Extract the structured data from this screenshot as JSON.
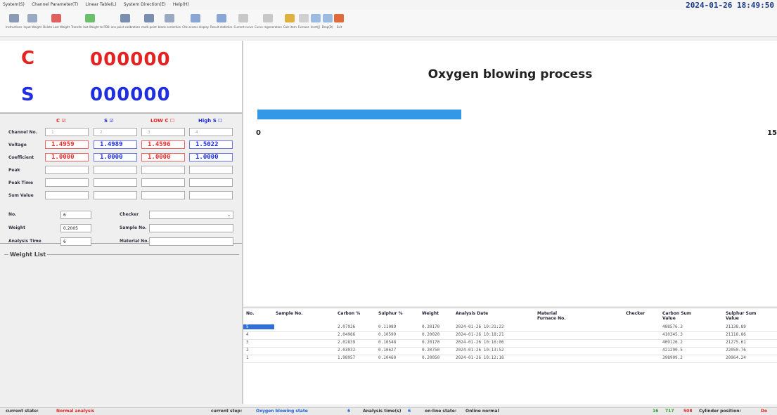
{
  "menu": {
    "items": [
      "System(S)",
      "Channel Parameter(T)",
      "Linear Table(L)",
      "System Direction(E)",
      "Help(H)"
    ],
    "datetime": "2024-01-26 18:49:50"
  },
  "toolbar": {
    "buttons": [
      {
        "label": "Instructions",
        "icon": "book-icon",
        "color": "#8a9bb5"
      },
      {
        "label": "Input Weight",
        "icon": "scale-icon",
        "color": "#9aa9c2"
      },
      {
        "label": "Delete Last Weight",
        "icon": "delete-icon",
        "color": "#e06060"
      },
      {
        "label": "Transfer last Weight to PDB",
        "icon": "transfer-icon",
        "color": "#6cbf6c"
      },
      {
        "label": "one point calibration",
        "icon": "calibration-icon",
        "color": "#7a8fb0"
      },
      {
        "label": "multi-point",
        "icon": "grid-icon",
        "color": "#7a8fb0"
      },
      {
        "label": "blank correction",
        "icon": "correction-icon",
        "color": "#9aa9c2"
      },
      {
        "label": "Chk access display",
        "icon": "magnifier-icon",
        "color": "#8aa6d4"
      },
      {
        "label": "Result statistics",
        "icon": "statistics-icon",
        "color": "#8aa6d4"
      },
      {
        "label": "Current curve",
        "icon": "curve-icon",
        "color": "#c8c8c8"
      },
      {
        "label": "Curve regeneration",
        "icon": "regenerate-icon",
        "color": "#c8c8c8"
      },
      {
        "label": "Calc item",
        "icon": "calc-icon",
        "color": "#e0b040"
      },
      {
        "label": "Furnace",
        "icon": "furnace-icon",
        "color": "#d0d0d0"
      },
      {
        "label": "Inert(J)",
        "icon": "inert-icon",
        "color": "#9bbbe0"
      },
      {
        "label": "Drop(D)",
        "icon": "drop-icon",
        "color": "#9bbbe0"
      },
      {
        "label": "Exit",
        "icon": "exit-icon",
        "color": "#e06a3a"
      }
    ]
  },
  "readout": {
    "c_label": "C",
    "c_value": "000000",
    "s_label": "S",
    "s_value": "000000",
    "c_color": "#e52222",
    "s_color": "#1f2ee0"
  },
  "channels": {
    "headers": [
      "C",
      "S",
      "LOW C",
      "High S"
    ],
    "checks": [
      true,
      true,
      false,
      false
    ],
    "rows": [
      {
        "label": "Channel No.",
        "values": [
          "1",
          "2",
          "3",
          "4"
        ]
      },
      {
        "label": "Voltage",
        "values": [
          "1.4959",
          "1.4989",
          "1.4596",
          "1.5022"
        ]
      },
      {
        "label": "Coefficient",
        "values": [
          "1.0000",
          "1.0000",
          "1.0000",
          "1.0000"
        ]
      },
      {
        "label": "Peak",
        "values": [
          "",
          "",
          "",
          ""
        ]
      },
      {
        "label": "Peak Time",
        "values": [
          "",
          "",
          "",
          ""
        ]
      },
      {
        "label": "Sum Value",
        "values": [
          "",
          "",
          "",
          ""
        ]
      }
    ]
  },
  "form": {
    "no_label": "No.",
    "no_value": "6",
    "weight_label": "Weight",
    "weight_value": "0.2005",
    "analysis_time_label": "Analysis Time",
    "analysis_time_value": "6",
    "checker_label": "Checker",
    "checker_value": "",
    "sample_label": "Sample No.",
    "sample_value": "",
    "material_label": "Material No.",
    "material_value": ""
  },
  "weight_list": {
    "title": "Weight List"
  },
  "process": {
    "title": "Oxygen blowing process",
    "progress_fraction": 0.33,
    "min_label": "0",
    "max_label": "15"
  },
  "results_table": {
    "headers": [
      "No.",
      "Sample No.",
      "Carbon %",
      "Sulphur %",
      "Weight",
      "Analysis Date",
      "Material Furnace No.",
      "Checker",
      "Carbon Sum Value",
      "Sulphur Sum Value"
    ],
    "rows": [
      {
        "no": "5",
        "sample": "",
        "carbon": "2.07926",
        "sulphur": "0.11089",
        "weight": "0.20170",
        "date": "2024-01-26 10:21:22",
        "furnace": "",
        "checker": "",
        "csum": "408576.3",
        "ssum": "21138.89"
      },
      {
        "no": "4",
        "sample": "",
        "carbon": "2.04986",
        "sulphur": "0.10599",
        "weight": "0.20020",
        "date": "2024-01-26 10:18:21",
        "furnace": "",
        "checker": "",
        "csum": "410345.3",
        "ssum": "21118.86"
      },
      {
        "no": "3",
        "sample": "",
        "carbon": "2.02839",
        "sulphur": "0.10548",
        "weight": "0.20170",
        "date": "2024-01-26 10:16:06",
        "furnace": "",
        "checker": "",
        "csum": "409126.2",
        "ssum": "21275.61"
      },
      {
        "no": "2",
        "sample": "",
        "carbon": "2.03032",
        "sulphur": "0.10627",
        "weight": "0.20750",
        "date": "2024-01-26 10:13:52",
        "furnace": "",
        "checker": "",
        "csum": "421290.5",
        "ssum": "22050.76"
      },
      {
        "no": "1",
        "sample": "",
        "carbon": "1.98957",
        "sulphur": "0.10460",
        "weight": "0.20050",
        "date": "2024-01-26 10:12:18",
        "furnace": "",
        "checker": "",
        "csum": "398909.2",
        "ssum": "20964.24"
      }
    ]
  },
  "status": {
    "state_label": "current state:",
    "state_value": "Normal analysis",
    "step_label": "current step:",
    "step_value": "Oxygen blowing state",
    "step_num": "6",
    "time_label": "Analysis time(s)",
    "time_value": "6",
    "online_label": "on-line state:",
    "online_value": "Online normal",
    "n1": "16",
    "n2": "717",
    "n3": "508",
    "cylinder_label": "Cylinder position:",
    "cylinder_value": "Do"
  }
}
